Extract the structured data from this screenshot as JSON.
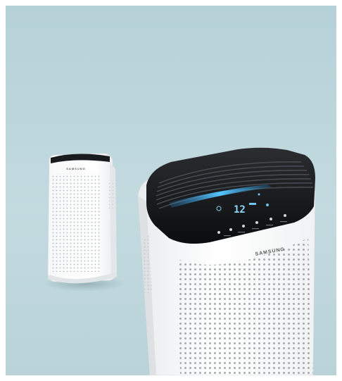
{
  "scene": {
    "background_color": "#bcd6dc",
    "products": [
      {
        "role": "small-purifier",
        "brand": "SAMSUNG"
      },
      {
        "role": "large-purifier",
        "brand": "SAMSUNG",
        "display_value": "12"
      }
    ],
    "accent_light_color": "#3fb6ff"
  }
}
